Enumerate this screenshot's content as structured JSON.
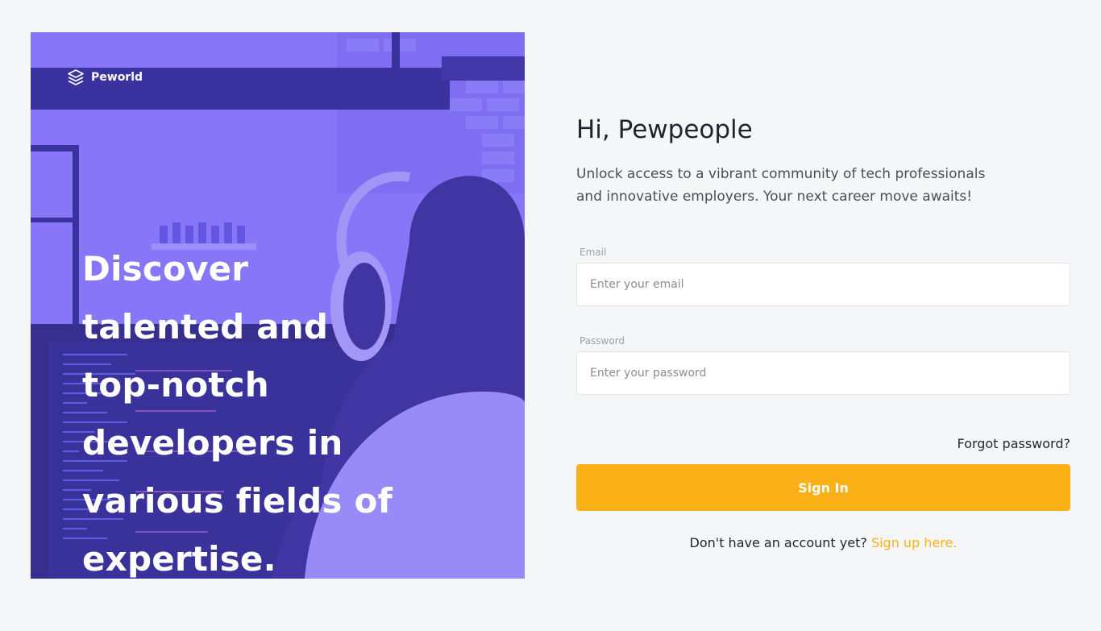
{
  "hero": {
    "brand_name": "Peworld",
    "headline": "Discover talented and top-notch developers in various fields of expertise."
  },
  "form": {
    "greeting": "Hi, Pewpeople",
    "intro": "Unlock access to a vibrant community of tech professionals and innovative employers. Your next career move awaits!",
    "email_label": "Email",
    "email_placeholder": "Enter your email",
    "password_label": "Password",
    "password_placeholder": "Enter your password",
    "forgot_password": "Forgot password?",
    "signin_label": "Sign In",
    "signup_prompt": "Don't have an account yet?",
    "signup_link": "Sign up here."
  },
  "colors": {
    "background": "#f5f6f8",
    "hero_overlay": "#5e50ef",
    "accent": "#fbb017",
    "text": "#1f2430"
  },
  "icons": {
    "logo": "stacked-layers-icon"
  }
}
